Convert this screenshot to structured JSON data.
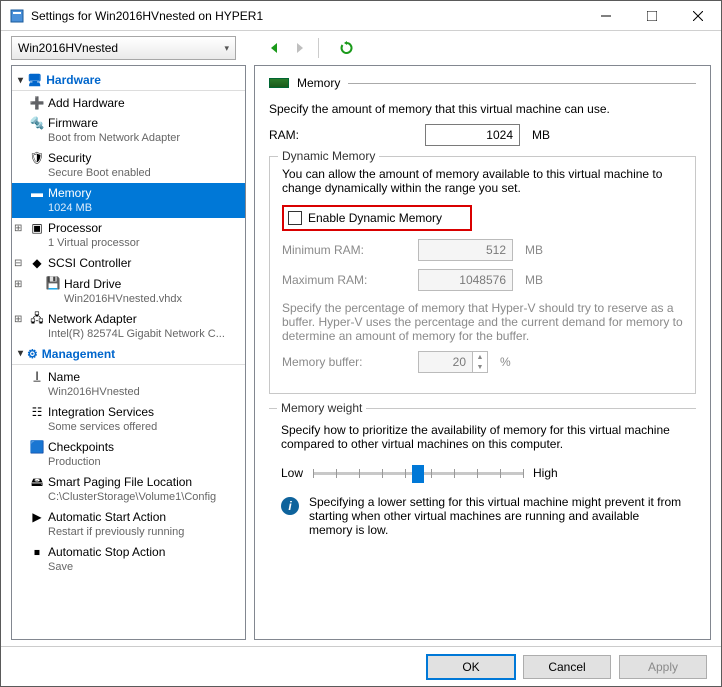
{
  "title": "Settings for Win2016HVnested on HYPER1",
  "vm_selector": "Win2016HVnested",
  "tree": {
    "hardware_header": "Hardware",
    "add_hardware": "Add Hardware",
    "firmware": {
      "label": "Firmware",
      "sub": "Boot from Network Adapter"
    },
    "security": {
      "label": "Security",
      "sub": "Secure Boot enabled"
    },
    "memory": {
      "label": "Memory",
      "sub": "1024 MB"
    },
    "processor": {
      "label": "Processor",
      "sub": "1 Virtual processor"
    },
    "scsi": {
      "label": "SCSI Controller"
    },
    "hard_drive": {
      "label": "Hard Drive",
      "sub": "Win2016HVnested.vhdx"
    },
    "network": {
      "label": "Network Adapter",
      "sub": "Intel(R) 82574L Gigabit Network C..."
    },
    "management_header": "Management",
    "name": {
      "label": "Name",
      "sub": "Win2016HVnested"
    },
    "integration": {
      "label": "Integration Services",
      "sub": "Some services offered"
    },
    "checkpoints": {
      "label": "Checkpoints",
      "sub": "Production"
    },
    "paging": {
      "label": "Smart Paging File Location",
      "sub": "C:\\ClusterStorage\\Volume1\\Config"
    },
    "autostart": {
      "label": "Automatic Start Action",
      "sub": "Restart if previously running"
    },
    "autostop": {
      "label": "Automatic Stop Action",
      "sub": "Save"
    }
  },
  "panel": {
    "heading": "Memory",
    "intro": "Specify the amount of memory that this virtual machine can use.",
    "ram_label": "RAM:",
    "ram_value": "1024",
    "ram_unit": "MB",
    "dyn": {
      "group_title": "Dynamic Memory",
      "desc": "You can allow the amount of memory available to this virtual machine to change dynamically within the range you set.",
      "enable_label": "Enable Dynamic Memory",
      "min_label": "Minimum RAM:",
      "min_value": "512",
      "min_unit": "MB",
      "max_label": "Maximum RAM:",
      "max_value": "1048576",
      "max_unit": "MB",
      "buffer_desc": "Specify the percentage of memory that Hyper-V should try to reserve as a buffer. Hyper-V uses the percentage and the current demand for memory to determine an amount of memory for the buffer.",
      "buffer_label": "Memory buffer:",
      "buffer_value": "20",
      "buffer_unit": "%"
    },
    "weight": {
      "group_title": "Memory weight",
      "desc": "Specify how to prioritize the availability of memory for this virtual machine compared to other virtual machines on this computer.",
      "low": "Low",
      "high": "High",
      "info": "Specifying a lower setting for this virtual machine might prevent it from starting when other virtual machines are running and available memory is low."
    }
  },
  "buttons": {
    "ok": "OK",
    "cancel": "Cancel",
    "apply": "Apply"
  }
}
